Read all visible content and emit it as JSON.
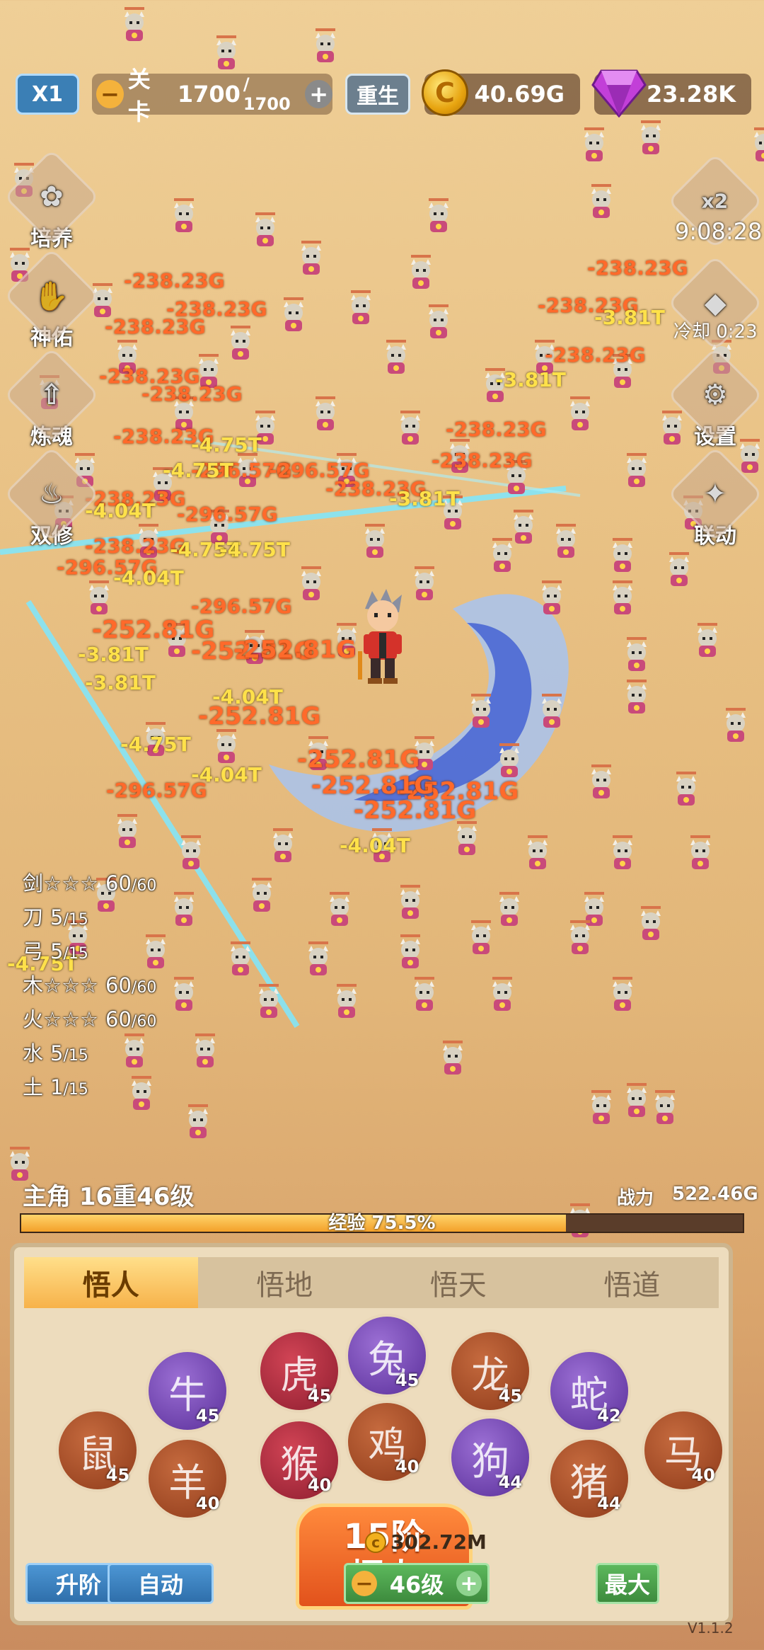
{
  "hud": {
    "speed": "X1",
    "stage_label": "关卡",
    "stage_current": "1700",
    "stage_max": "/ 1700",
    "rebirth": "重生",
    "gold": "40.69G",
    "gems": "23.28K",
    "gold_coin_glyph": "C"
  },
  "left_menu": [
    "培养",
    "神佑",
    "炼魂",
    "双修"
  ],
  "right_menu": {
    "boost_label": "x2",
    "boost_timer": "9:08:28",
    "cooldown": "冷却 0:23",
    "settings": "设置",
    "link": "联动"
  },
  "damage_numbers": {
    "orange": [
      "-238.23G",
      "-238.23G",
      "-238.23G",
      "-238.23G",
      "-238.23G",
      "-238.23G",
      "-238.23G",
      "-238.23G",
      "-238.23G",
      "-238.23G",
      "-238.23G",
      "-296.57G",
      "-296.57G",
      "-296.57G",
      "-296.57G",
      "-296.57G",
      "-252.81G",
      "-252.81G",
      "-252.81G",
      "-252.81G",
      "-252.81G",
      "-252.81G",
      "-252.81G",
      "-252.81G",
      "-238.23G",
      "-238.23G",
      "-238.23G",
      "-296.57G"
    ],
    "yellow": [
      "-3.81T",
      "-3.81T",
      "-4.75T",
      "-4.75T",
      "-4.04T",
      "-4.75T",
      "-4.75T",
      "-4.04T",
      "-3.81T",
      "-4.04T",
      "-4.75T",
      "-4.04T",
      "-4.04T",
      "-3.81T",
      "-3.81T",
      "-4.75T"
    ]
  },
  "stats": [
    {
      "name": "剑",
      "rank": "☆☆☆",
      "cur": "60",
      "max": "/60"
    },
    {
      "name": "刀",
      "rank": "",
      "cur": "5",
      "max": "/15"
    },
    {
      "name": "弓",
      "rank": "",
      "cur": "5",
      "max": "/15"
    },
    {
      "name": "木",
      "rank": "☆☆☆",
      "cur": "60",
      "max": "/60"
    },
    {
      "name": "火",
      "rank": "☆☆☆",
      "cur": "60",
      "max": "/60"
    },
    {
      "name": "水",
      "rank": "",
      "cur": "5",
      "max": "/15"
    },
    {
      "name": "土",
      "rank": "",
      "cur": "1",
      "max": "/15"
    }
  ],
  "hero": {
    "title": "主角 16重46级",
    "power_label": "战力",
    "power": "522.46G",
    "exp_text": "经验 75.5%",
    "exp_fraction": 0.755
  },
  "panel": {
    "tabs": [
      "悟人",
      "悟地",
      "悟天",
      "悟道"
    ],
    "active_tab": 0,
    "zodiac": [
      {
        "icon": "rat-icon",
        "glyph": "鼠",
        "level": "45",
        "tone": "z-brown"
      },
      {
        "icon": "ox-icon",
        "glyph": "牛",
        "level": "45",
        "tone": "z-purple"
      },
      {
        "icon": "goat-icon",
        "glyph": "羊",
        "level": "40",
        "tone": "z-brown"
      },
      {
        "icon": "tiger-icon",
        "glyph": "虎",
        "level": "45",
        "tone": "z-red"
      },
      {
        "icon": "monkey-icon",
        "glyph": "猴",
        "level": "40",
        "tone": "z-red"
      },
      {
        "icon": "rabbit-icon",
        "glyph": "兔",
        "level": "45",
        "tone": "z-purple"
      },
      {
        "icon": "rooster-icon",
        "glyph": "鸡",
        "level": "40",
        "tone": "z-brown"
      },
      {
        "icon": "dragon-icon",
        "glyph": "龙",
        "level": "45",
        "tone": "z-brown"
      },
      {
        "icon": "dog-icon",
        "glyph": "狗",
        "level": "44",
        "tone": "z-purple"
      },
      {
        "icon": "snake-icon",
        "glyph": "蛇",
        "level": "42",
        "tone": "z-purple"
      },
      {
        "icon": "pig-icon",
        "glyph": "猪",
        "level": "44",
        "tone": "z-brown"
      },
      {
        "icon": "horse-icon",
        "glyph": "马",
        "level": "40",
        "tone": "z-brown"
      }
    ],
    "big_button_line1": "15阶",
    "big_button_line2": "悟人",
    "upgrade": "升阶",
    "auto": "自动",
    "cost": "302.72M",
    "level": "46级",
    "max": "最大"
  },
  "version": "V1.1.2"
}
